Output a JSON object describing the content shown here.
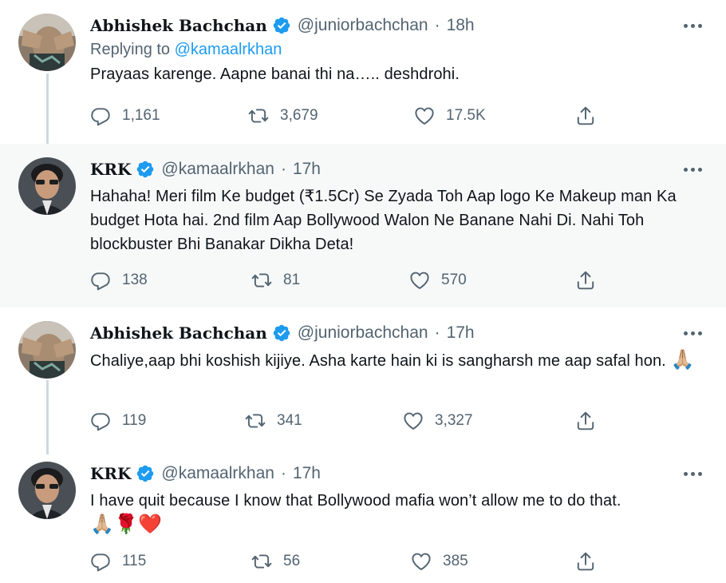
{
  "tweets": [
    {
      "name": "Abhishek Bachchan",
      "handle": "@juniorbachchan",
      "time": "18h",
      "replying_prefix": "Replying to",
      "replying_handle": "@kamaalrkhan",
      "text": "Prayaas karenge. Aapne banai thi na….. deshdrohi.",
      "replies": "1,161",
      "retweets": "3,679",
      "likes": "17.5K"
    },
    {
      "name": "KRK",
      "handle": "@kamaalrkhan",
      "time": "17h",
      "text": "Hahaha! Meri film Ke budget (₹1.5Cr) Se Zyada Toh Aap logo Ke Makeup man Ka budget Hota hai. 2nd film Aap Bollywood Walon Ne Banane Nahi Di. Nahi Toh blockbuster Bhi Banakar Dikha Deta!",
      "replies": "138",
      "retweets": "81",
      "likes": "570"
    },
    {
      "name": "Abhishek Bachchan",
      "handle": "@juniorbachchan",
      "time": "17h",
      "text": "Chaliye,aap bhi koshish kijiye. Asha karte hain ki is sangharsh me aap safal hon.",
      "emoji": "🙏🏼",
      "replies": "119",
      "retweets": "341",
      "likes": "3,327"
    },
    {
      "name": "KRK",
      "handle": "@kamaalrkhan",
      "time": "17h",
      "text": "I have quit because I know that Bollywood mafia won’t allow me to do that.",
      "emoji": "🙏🏼🌹❤️",
      "replies": "115",
      "retweets": "56",
      "likes": "385"
    }
  ],
  "colors": {
    "accent": "#1d9bf0",
    "secondary_text": "#536471",
    "highlight_bg": "#f7f9f9",
    "thread_line": "#cfd9de"
  },
  "icons": [
    "verified-badge-icon",
    "more-icon",
    "reply-icon",
    "retweet-icon",
    "like-icon",
    "share-icon"
  ]
}
